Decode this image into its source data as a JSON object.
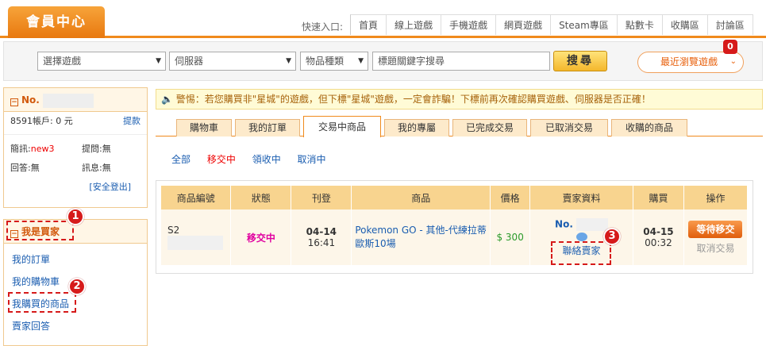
{
  "header": {
    "logo": "會員中心",
    "quick_label": "快速入口:",
    "nav": [
      "首頁",
      "線上遊戲",
      "手機遊戲",
      "網頁遊戲",
      "Steam專區",
      "點數卡",
      "收購區",
      "討論區"
    ]
  },
  "search": {
    "game_select": "選擇遊戲",
    "server_select": "伺服器",
    "type_select": "物品種類",
    "keyword_placeholder": "標題關鍵字搜尋",
    "search_button": "搜尋",
    "recent_button": "最近瀏覽遊戲",
    "recent_badge": "0"
  },
  "sidebar": {
    "member_prefix": "No.",
    "account_label": "8591帳戶:",
    "balance": "0 元",
    "withdraw": "提款",
    "news_label": "簡訊:",
    "news_count": "new3",
    "question_label": "提問:",
    "question_value": "無",
    "reply_label": "回答:",
    "reply_value": "無",
    "message_label": "訊息:",
    "message_value": "無",
    "logout": "[安全登出]",
    "buyer_title": "我是買家",
    "menu": [
      "我的訂單",
      "我的購物車",
      "我購買的商品",
      "賣家回答"
    ]
  },
  "warning": "警惕：若您購買非\"星城\"的遊戲，但下標\"星城\"遊戲，一定會詐騙！下標前再次確認購買遊戲、伺服器是否正確！",
  "tabs": [
    "購物車",
    "我的訂單",
    "交易中商品",
    "我的專屬",
    "已完成交易",
    "已取消交易",
    "收購的商品"
  ],
  "active_tab": "交易中商品",
  "subtabs": [
    "全部",
    "移交中",
    "領收中",
    "取消中"
  ],
  "active_subtab": "移交中",
  "table": {
    "headers": [
      "商品編號",
      "狀態",
      "刊登",
      "商品",
      "價格",
      "賣家資料",
      "購買",
      "操作"
    ],
    "row": {
      "id_prefix": "S2",
      "status": "移交中",
      "post_date": "04-14",
      "post_time": "16:41",
      "product": "Pokemon GO - 其他-代練拉蒂歐斯10場",
      "price": "$ 300",
      "seller_prefix": "No.",
      "contact": "聯絡賣家",
      "buy_date": "04-15",
      "buy_time": "00:32",
      "action": "等待移交",
      "cancel": "取消交易"
    }
  },
  "callouts": [
    "1",
    "2",
    "3"
  ]
}
